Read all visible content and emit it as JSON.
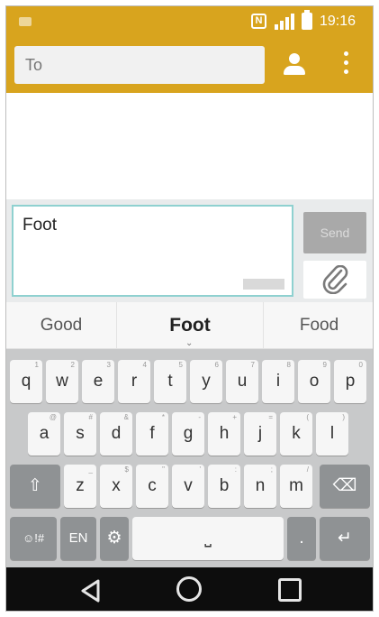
{
  "status_bar": {
    "nfc_label": "N",
    "time": "19:16"
  },
  "header": {
    "to_placeholder": "To"
  },
  "compose": {
    "text": "Foot",
    "send_label": "Send"
  },
  "suggestions": {
    "left": "Good",
    "center": "Foot",
    "right": "Food"
  },
  "keyboard": {
    "row1": [
      {
        "label": "q",
        "hint": "1"
      },
      {
        "label": "w",
        "hint": "2"
      },
      {
        "label": "e",
        "hint": "3"
      },
      {
        "label": "r",
        "hint": "4"
      },
      {
        "label": "t",
        "hint": "5"
      },
      {
        "label": "y",
        "hint": "6"
      },
      {
        "label": "u",
        "hint": "7"
      },
      {
        "label": "i",
        "hint": "8"
      },
      {
        "label": "o",
        "hint": "9"
      },
      {
        "label": "p",
        "hint": "0"
      }
    ],
    "row2": [
      {
        "label": "a",
        "hint": "@"
      },
      {
        "label": "s",
        "hint": "#"
      },
      {
        "label": "d",
        "hint": "&"
      },
      {
        "label": "f",
        "hint": "*"
      },
      {
        "label": "g",
        "hint": "-"
      },
      {
        "label": "h",
        "hint": "+"
      },
      {
        "label": "j",
        "hint": "="
      },
      {
        "label": "k",
        "hint": "("
      },
      {
        "label": "l",
        "hint": ")"
      }
    ],
    "row3": [
      {
        "label": "z",
        "hint": "_"
      },
      {
        "label": "x",
        "hint": "$"
      },
      {
        "label": "c",
        "hint": "\""
      },
      {
        "label": "v",
        "hint": "'"
      },
      {
        "label": "b",
        "hint": ":"
      },
      {
        "label": "n",
        "hint": ";"
      },
      {
        "label": "m",
        "hint": "/"
      }
    ],
    "shift_icon": "⇧",
    "backspace_icon": "⌫",
    "symbols_label": "☺!#",
    "language_label": "EN",
    "settings_icon": "⚙",
    "space_symbol": "⎵",
    "period_label": ".",
    "enter_icon": "↵"
  },
  "colors": {
    "accent": "#d8a41e",
    "keyboard_bg": "#c8c9ca",
    "input_border": "#8fd1d0"
  }
}
